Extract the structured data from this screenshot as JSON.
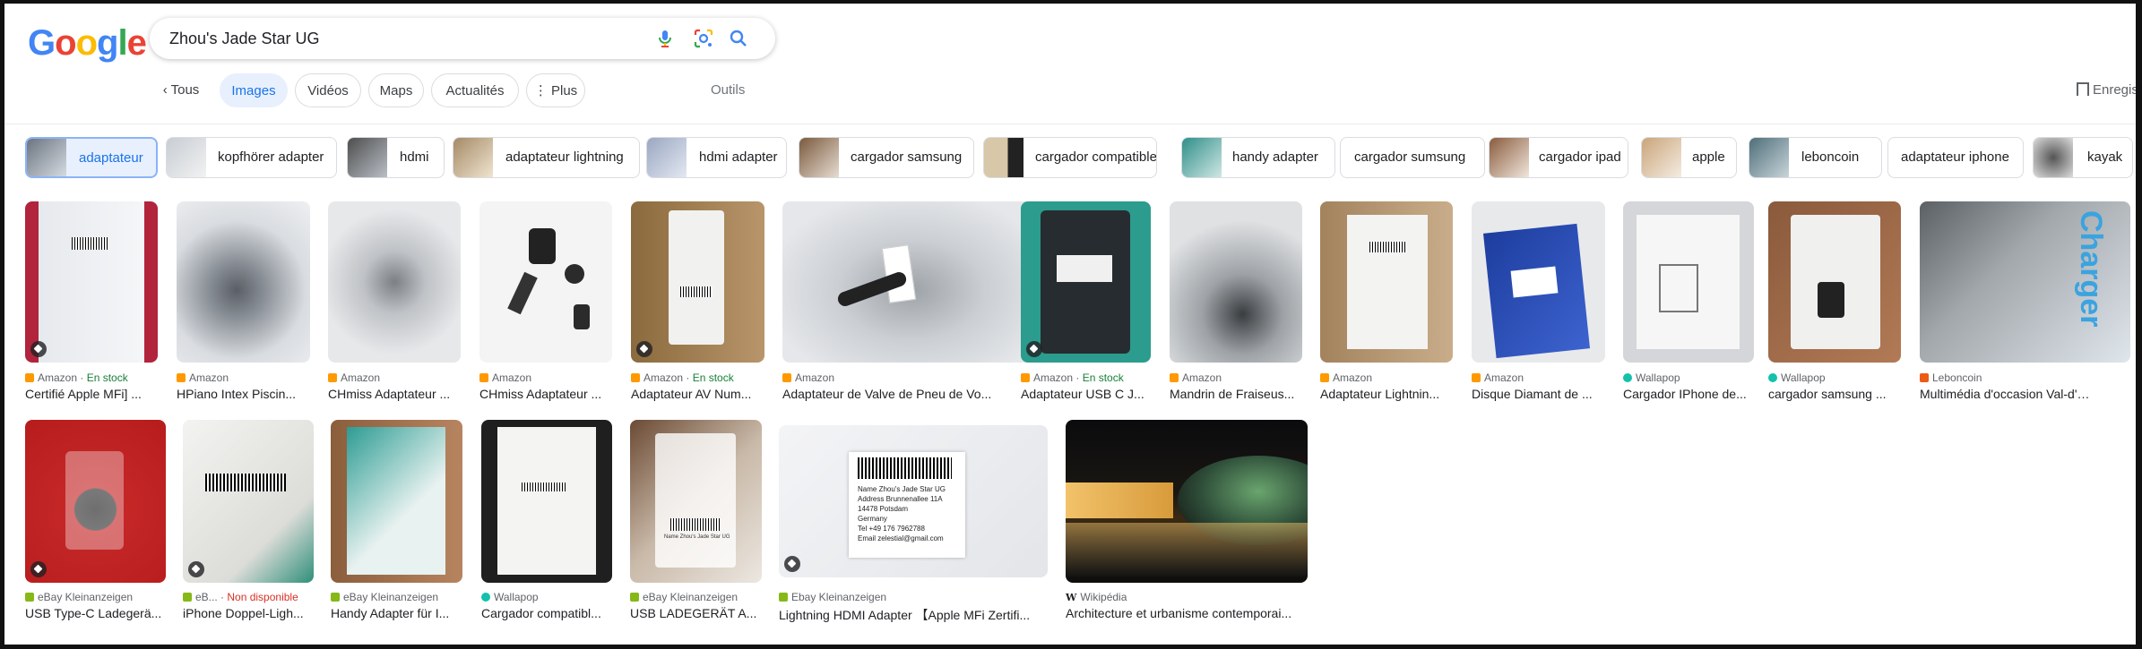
{
  "search": {
    "query": "Zhou's Jade Star UG"
  },
  "logo": {
    "letters": [
      "G",
      "o",
      "o",
      "g",
      "l",
      "e"
    ],
    "colors": [
      "#4285f4",
      "#ea4335",
      "#fbbc05",
      "#4285f4",
      "#34a853",
      "#ea4335"
    ]
  },
  "nav": {
    "back_label": "Tous",
    "tabs": [
      "Images",
      "Vidéos",
      "Maps",
      "Actualités",
      "Plus"
    ],
    "tools_label": "Outils",
    "save_label": "Enregis"
  },
  "chips": [
    "adaptateur",
    "kopfhörer adapter",
    "hdmi",
    "adaptateur lightning",
    "hdmi adapter",
    "cargador samsung",
    "cargador compatible",
    "handy adapter",
    "cargador sumsung",
    "cargador ipad",
    "apple",
    "leboncoin",
    "adaptateur iphone",
    "kayak"
  ],
  "results_row1": [
    {
      "source": "Amazon",
      "stock": "En stock",
      "title": "Certifié Apple MFi] ..."
    },
    {
      "source": "Amazon",
      "stock": "",
      "title": "HPiano Intex Piscin..."
    },
    {
      "source": "Amazon",
      "stock": "",
      "title": "CHmiss Adaptateur ..."
    },
    {
      "source": "Amazon",
      "stock": "",
      "title": "CHmiss Adaptateur ..."
    },
    {
      "source": "Amazon",
      "stock": "En stock",
      "title": "Adaptateur AV Num..."
    },
    {
      "source": "Amazon",
      "stock": "",
      "title": "Adaptateur de Valve de Pneu de Vo..."
    },
    {
      "source": "Amazon",
      "stock": "En stock",
      "title": "Adaptateur USB C J..."
    },
    {
      "source": "Amazon",
      "stock": "",
      "title": "Mandrin de Fraiseus..."
    },
    {
      "source": "Amazon",
      "stock": "",
      "title": "Adaptateur Lightnin..."
    },
    {
      "source": "Amazon",
      "stock": "",
      "title": "Disque Diamant de ..."
    },
    {
      "source": "Wallapop",
      "stock": "",
      "title": "Cargador IPhone de..."
    },
    {
      "source": "Wallapop",
      "stock": "",
      "title": "cargador samsung ..."
    },
    {
      "source": "Leboncoin",
      "stock": "",
      "title": "Multimédia d'occasion Val-d'Oise ..."
    }
  ],
  "results_row2": [
    {
      "source": "eBay Kleinanzeigen",
      "stock": "",
      "title": "USB Type-C Ladegerä..."
    },
    {
      "source": "eB...",
      "stock": "Non disponible",
      "title": "iPhone Doppel-Ligh..."
    },
    {
      "source": "eBay Kleinanzeigen",
      "stock": "",
      "title": "Handy Adapter für I..."
    },
    {
      "source": "Wallapop",
      "stock": "",
      "title": "Cargador compatibl..."
    },
    {
      "source": "eBay Kleinanzeigen",
      "stock": "",
      "title": "USB LADEGERÄT A..."
    },
    {
      "source": "Ebay Kleinanzeigen",
      "stock": "",
      "title": "Lightning HDMI Adapter 【Apple MFi Zertifi..."
    },
    {
      "source": "Wikipédia",
      "stock": "",
      "title": "Architecture et urbanisme contemporai..."
    }
  ],
  "image_text": {
    "r1_12": "Charger",
    "r2_5_label": "Name  Zhou's Jade Star UG",
    "r2_6_lines": [
      "Name Zhou's Jade Star UG",
      "Address Brunnenallee 11A",
      "14478 Potsdam",
      "Germany",
      "Tel +49 176 7962788",
      "Email zelestial@gmail.com"
    ]
  },
  "colors": {
    "accent": "#1a73e8",
    "stock": "#188038",
    "unavailable": "#d93025"
  }
}
